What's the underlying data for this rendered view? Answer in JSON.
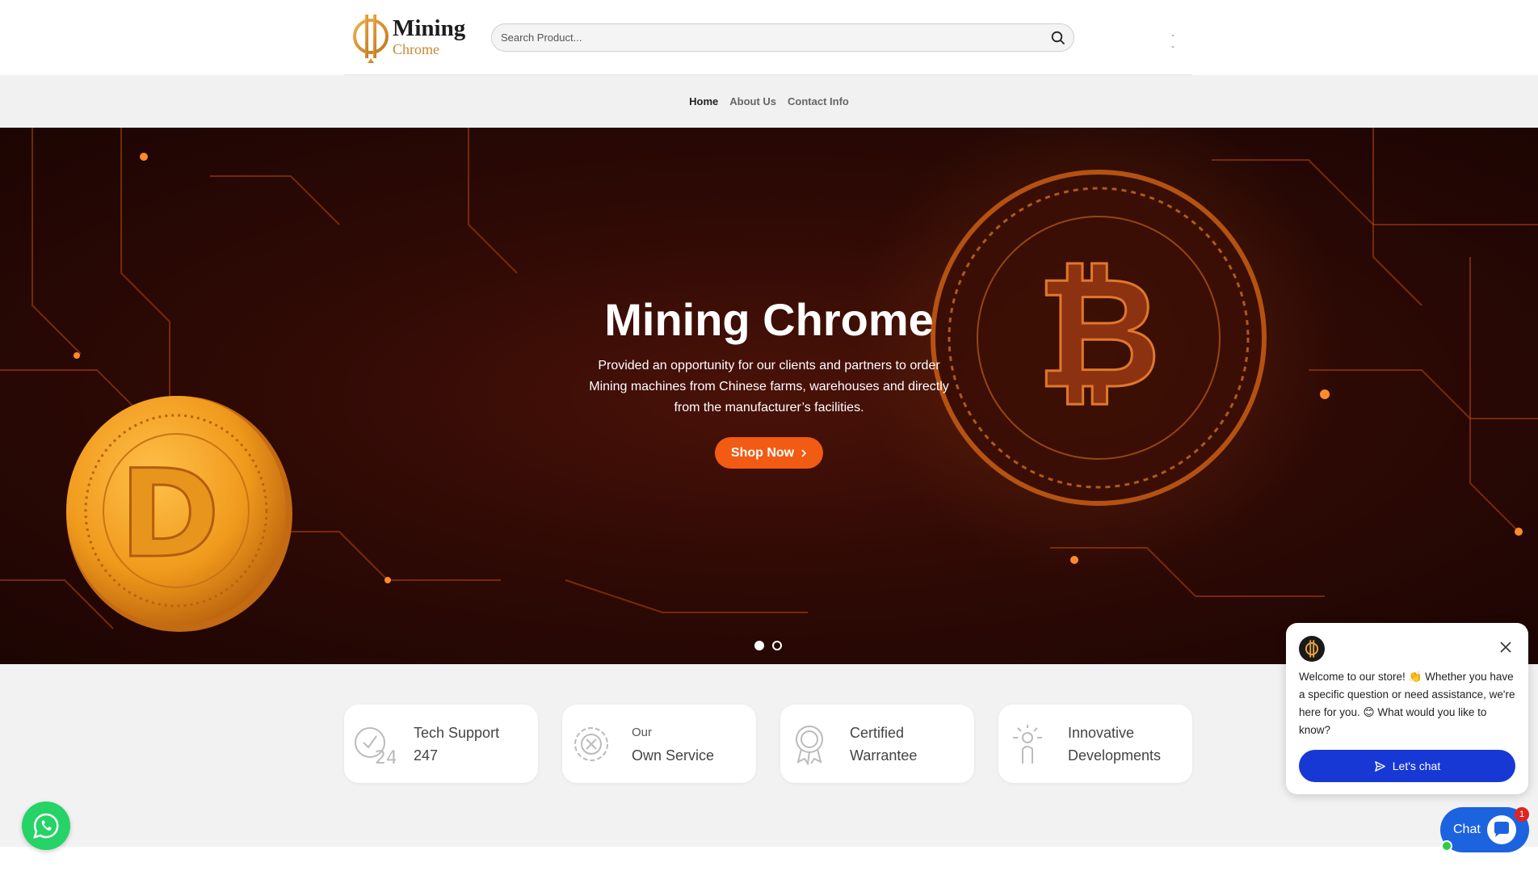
{
  "brand": {
    "name": "Mining",
    "sub": "Chrome"
  },
  "search": {
    "placeholder": "Search Product..."
  },
  "header": {
    "dashes": "- -"
  },
  "nav": [
    {
      "label": "Home",
      "active": true
    },
    {
      "label": "About Us",
      "active": false
    },
    {
      "label": "Contact Info",
      "active": false
    }
  ],
  "hero": {
    "title": "Mining Chrome",
    "description": "Provided an opportunity for our clients and partners to order Mining machines from Chinese farms, warehouses and directly from the manufacturer’s facilities.",
    "button": "Shop Now",
    "slides": 2,
    "active_slide": 1
  },
  "features": [
    {
      "line1": "Tech Support",
      "line2": "247",
      "icon": "clock-24-icon"
    },
    {
      "line1": "Our",
      "line2": "Own Service",
      "icon": "gear-wrench-icon"
    },
    {
      "line1": "Certified",
      "line2": "Warrantee",
      "icon": "award-badge-icon"
    },
    {
      "line1": "Innovative",
      "line2": "Developments",
      "icon": "innovation-hand-icon"
    }
  ],
  "chat": {
    "message": "Welcome to our store! 👏 Whether you have a specific question or need assistance, we're here for you. 😊 What would you like to know?",
    "button": "Let's chat",
    "launcher": "Chat",
    "badge": "1"
  },
  "colors": {
    "accent": "#f25b13",
    "brand_gold": "#c88a34",
    "chat_blue": "#1838d6",
    "whatsapp": "#25d366"
  }
}
